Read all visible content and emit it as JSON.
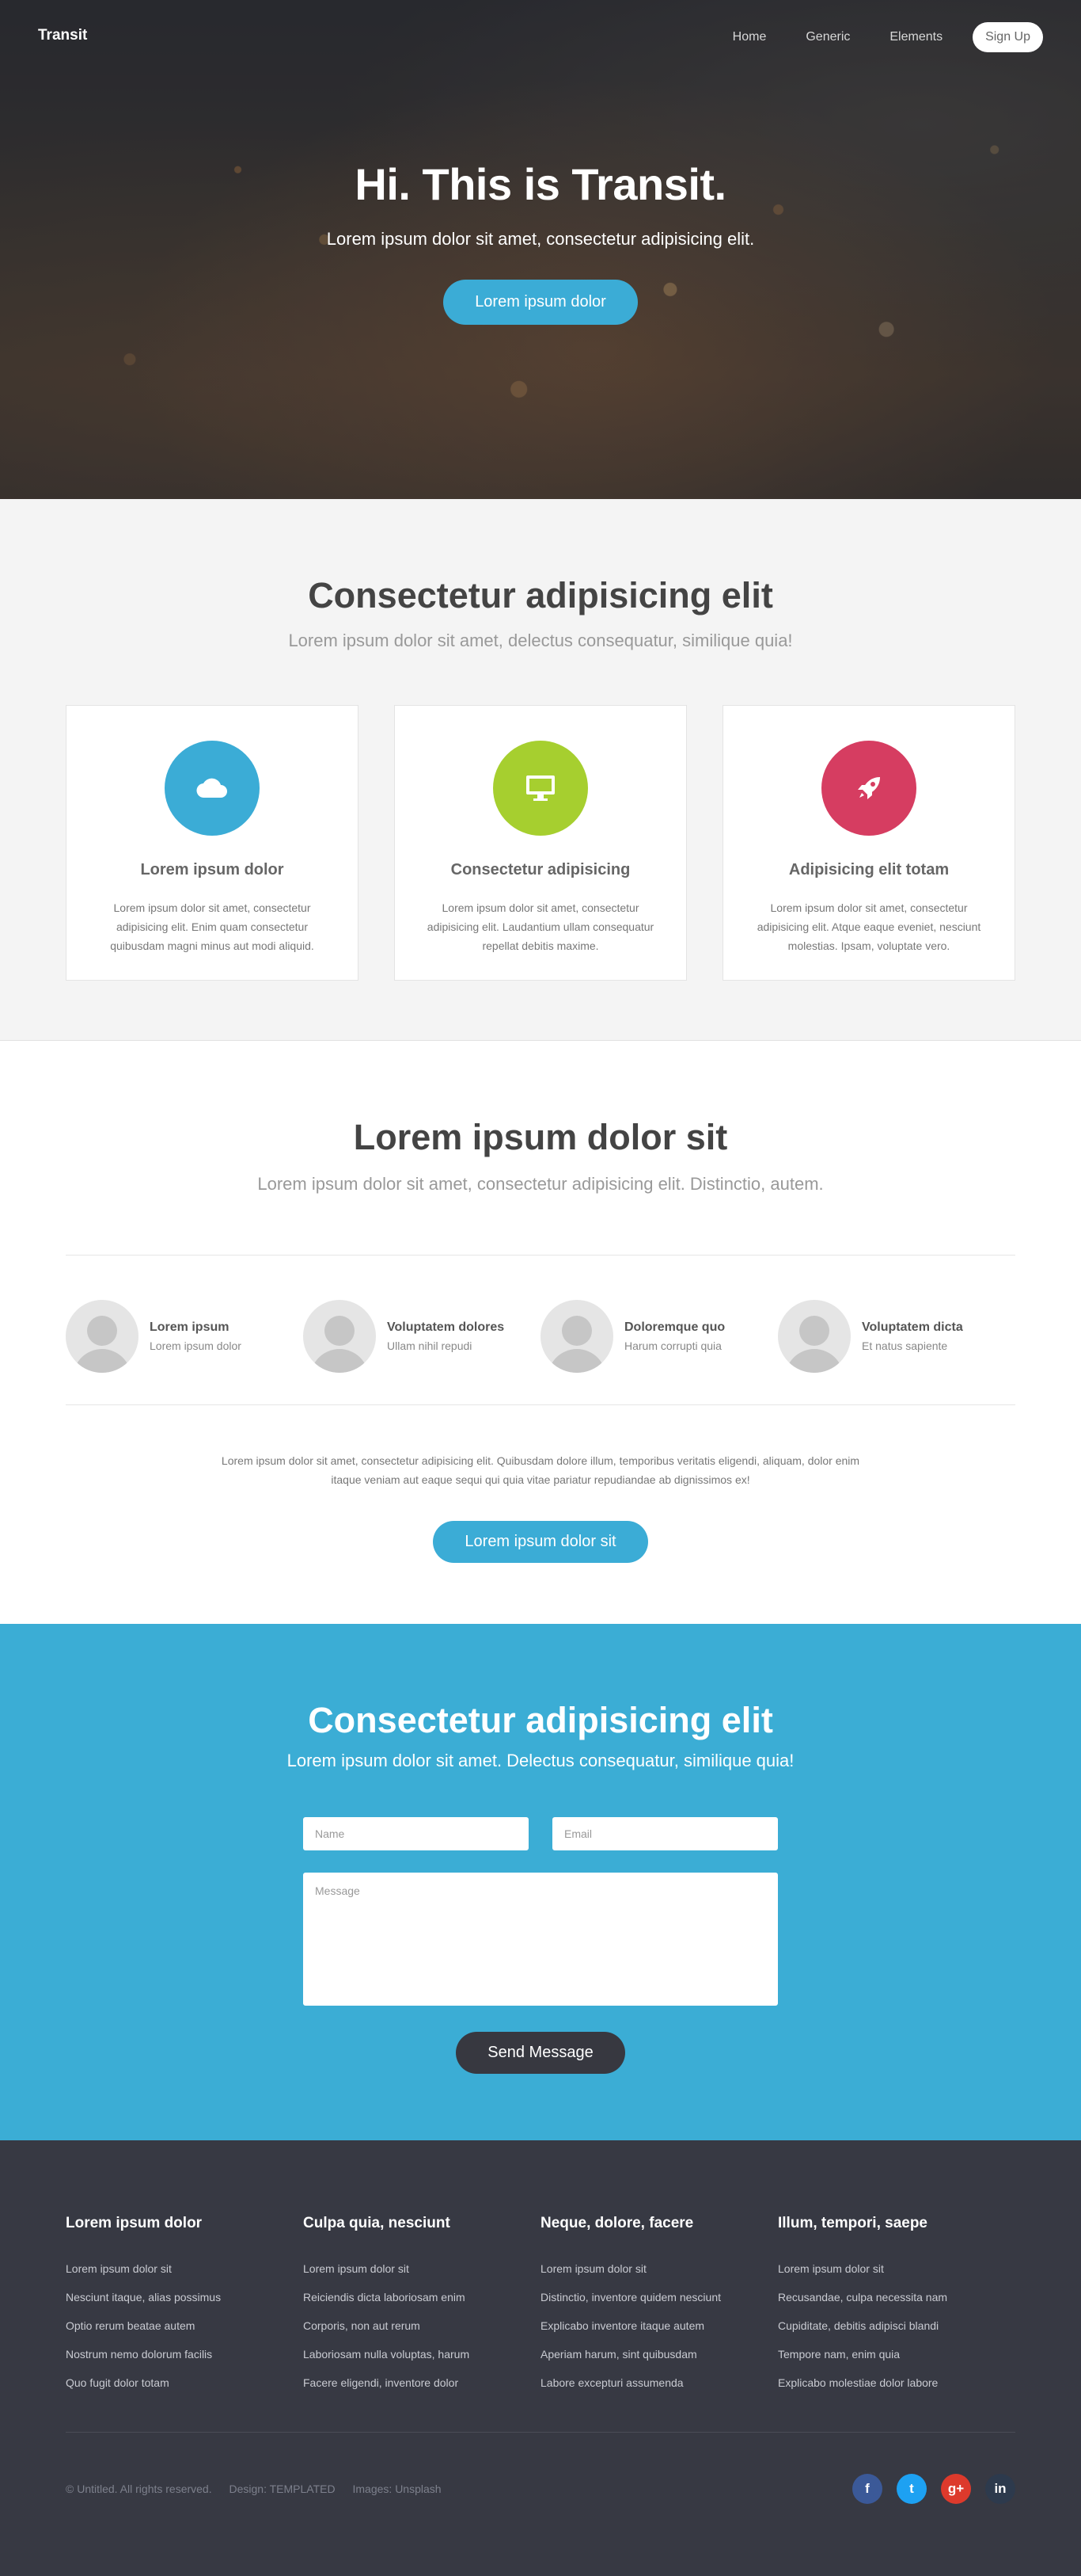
{
  "header": {
    "logo": "Transit",
    "nav": [
      "Home",
      "Generic",
      "Elements"
    ],
    "signup_label": "Sign Up"
  },
  "hero": {
    "title": "Hi. This is Transit.",
    "subtitle": "Lorem ipsum dolor sit amet, consectetur adipisicing elit.",
    "button_label": "Lorem ipsum dolor"
  },
  "features": {
    "title": "Consectetur adipisicing elit",
    "subtitle": "Lorem ipsum dolor sit amet, delectus consequatur, similique quia!",
    "cards": [
      {
        "icon": "cloud-icon",
        "color": "#3bacd6",
        "title": "Lorem ipsum dolor",
        "text": "Lorem ipsum dolor sit amet, consectetur adipisicing elit. Enim quam consectetur quibusdam magni minus aut modi aliquid."
      },
      {
        "icon": "desktop-icon",
        "color": "#a6cf2f",
        "title": "Consectetur adipisicing",
        "text": "Lorem ipsum dolor sit amet, consectetur adipisicing elit. Laudantium ullam consequatur repellat debitis maxime."
      },
      {
        "icon": "rocket-icon",
        "color": "#d63d61",
        "title": "Adipisicing elit totam",
        "text": "Lorem ipsum dolor sit amet, consectetur adipisicing elit. Atque eaque eveniet, nesciunt molestias. Ipsam, voluptate vero."
      }
    ]
  },
  "team": {
    "title": "Lorem ipsum dolor sit",
    "subtitle": "Lorem ipsum dolor sit amet, consectetur adipisicing elit. Distinctio, autem.",
    "people": [
      {
        "name": "Lorem ipsum",
        "role": "Lorem ipsum dolor"
      },
      {
        "name": "Voluptatem dolores",
        "role": "Ullam nihil repudi"
      },
      {
        "name": "Doloremque quo",
        "role": "Harum corrupti quia"
      },
      {
        "name": "Voluptatem dicta",
        "role": "Et natus sapiente"
      }
    ],
    "text": "Lorem ipsum dolor sit amet, consectetur adipisicing elit. Quibusdam dolore illum, temporibus veritatis eligendi, aliquam, dolor enim itaque veniam aut eaque sequi qui quia vitae pariatur repudiandae ab dignissimos ex!",
    "button_label": "Lorem ipsum dolor sit"
  },
  "contact": {
    "title": "Consectetur adipisicing elit",
    "subtitle": "Lorem ipsum dolor sit amet. Delectus consequatur, similique quia!",
    "name_placeholder": "Name",
    "email_placeholder": "Email",
    "message_placeholder": "Message",
    "send_label": "Send Message"
  },
  "footer": {
    "columns": [
      {
        "title": "Lorem ipsum dolor",
        "links": [
          "Lorem ipsum dolor sit",
          "Nesciunt itaque, alias possimus",
          "Optio rerum beatae autem",
          "Nostrum nemo dolorum facilis",
          "Quo fugit dolor totam"
        ]
      },
      {
        "title": "Culpa quia, nesciunt",
        "links": [
          "Lorem ipsum dolor sit",
          "Reiciendis dicta laboriosam enim",
          "Corporis, non aut rerum",
          "Laboriosam nulla voluptas, harum",
          "Facere eligendi, inventore dolor"
        ]
      },
      {
        "title": "Neque, dolore, facere",
        "links": [
          "Lorem ipsum dolor sit",
          "Distinctio, inventore quidem nesciunt",
          "Explicabo inventore itaque autem",
          "Aperiam harum, sint quibusdam",
          "Labore excepturi assumenda"
        ]
      },
      {
        "title": "Illum, tempori, saepe",
        "links": [
          "Lorem ipsum dolor sit",
          "Recusandae, culpa necessita nam",
          "Cupiditate, debitis adipisci blandi",
          "Tempore nam, enim quia",
          "Explicabo molestiae dolor labore"
        ]
      }
    ],
    "copyright": "© Untitled. All rights reserved.",
    "design": "Design: TEMPLATED",
    "images": "Images: Unsplash",
    "socials": [
      {
        "icon": "facebook-icon",
        "glyph": "f",
        "color": "#3b5998"
      },
      {
        "icon": "twitter-icon",
        "glyph": "t",
        "color": "#1da1f2"
      },
      {
        "icon": "google-plus-icon",
        "glyph": "g+",
        "color": "#dd3a2c"
      },
      {
        "icon": "linkedin-icon",
        "glyph": "in",
        "color": "#2d3a4d"
      }
    ]
  }
}
